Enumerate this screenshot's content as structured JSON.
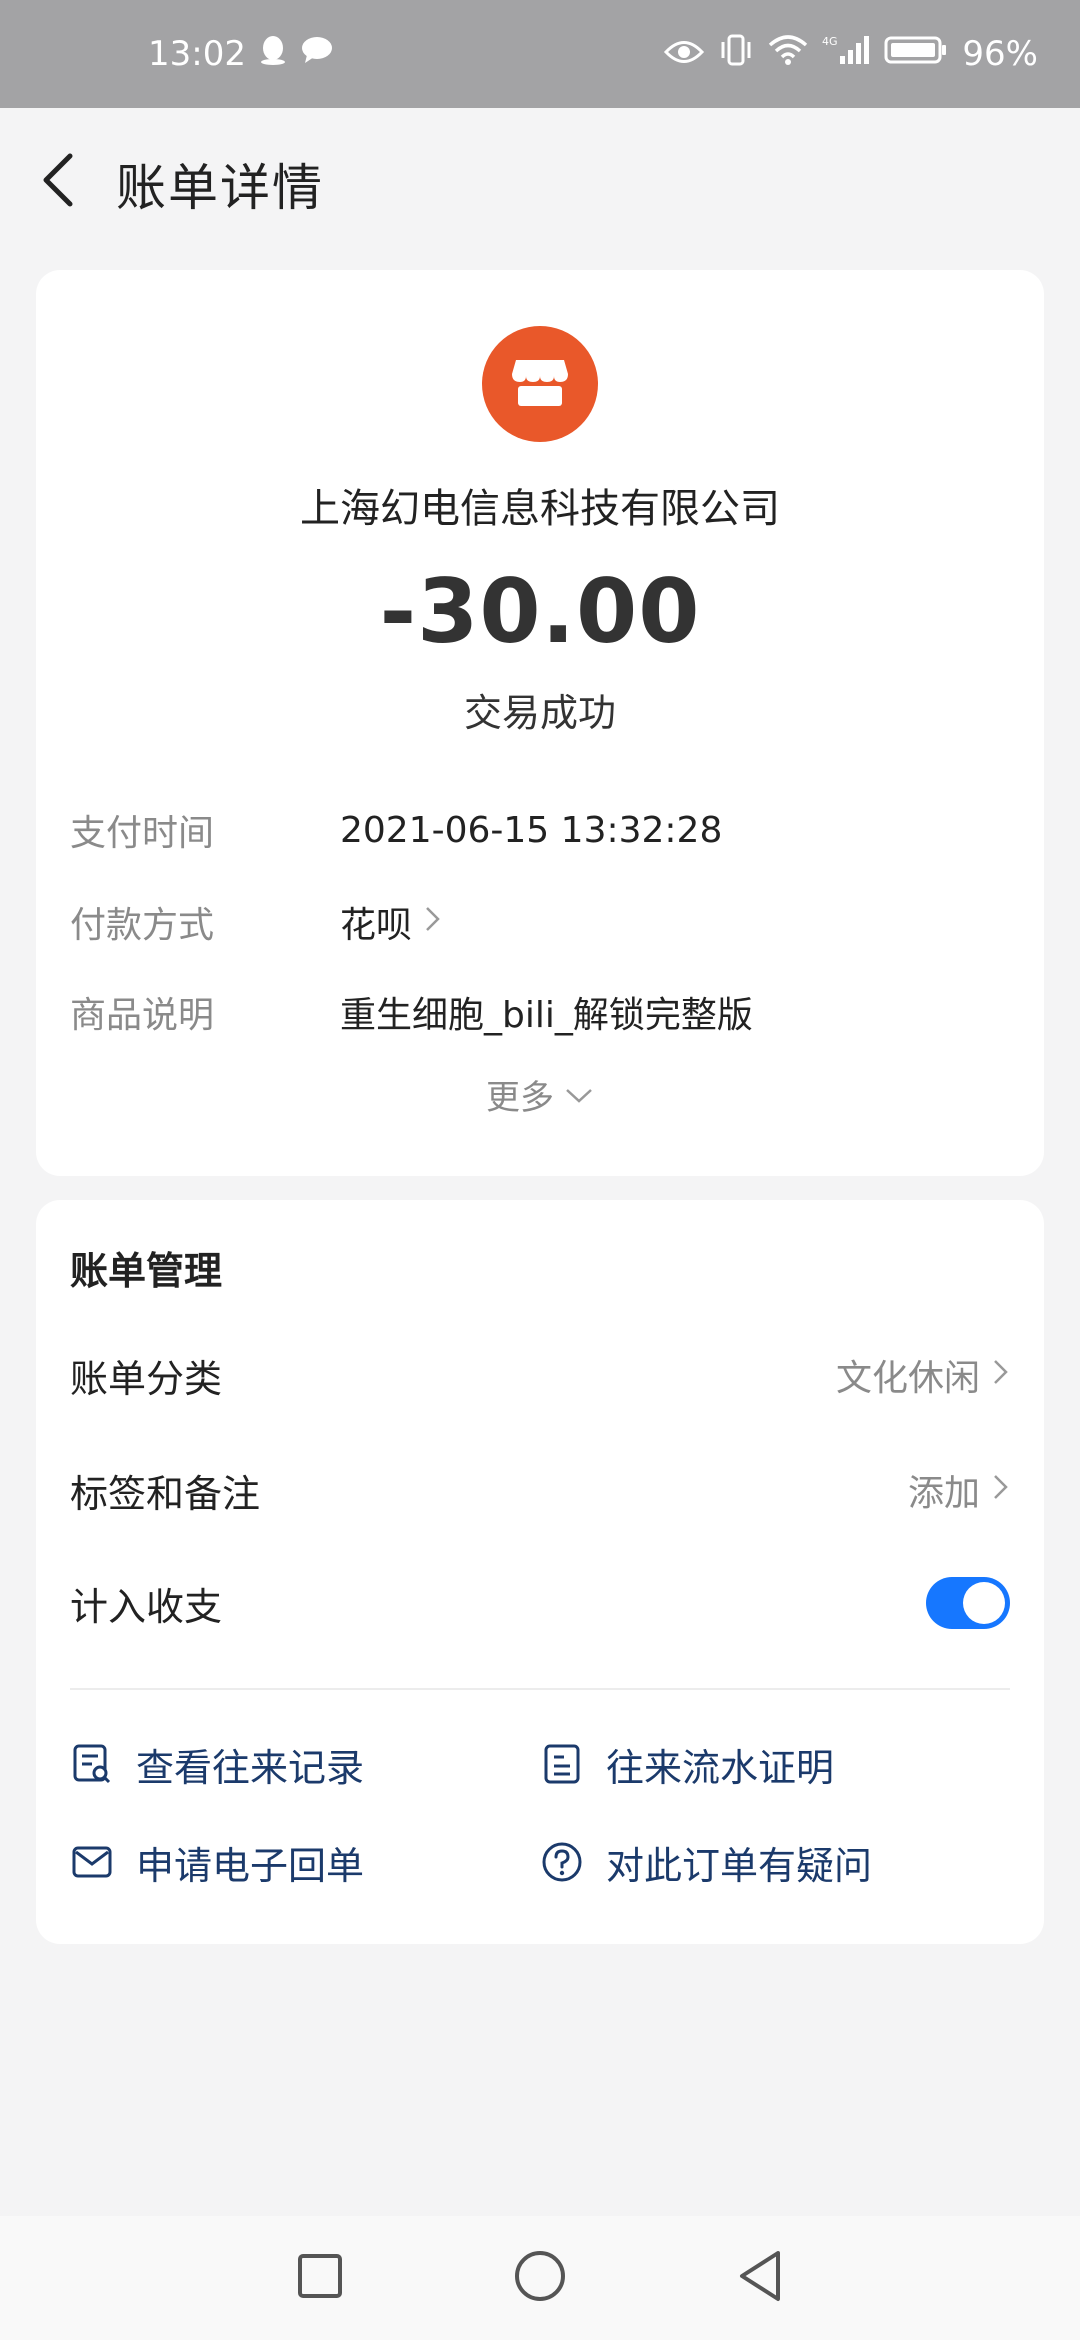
{
  "status_bar": {
    "time": "13:02",
    "battery": "96%",
    "network": "4G",
    "icons": [
      "qq-icon",
      "chat-bubble-icon",
      "eye-icon",
      "vibrate-icon",
      "wifi-icon",
      "signal-icon",
      "battery-icon"
    ]
  },
  "header": {
    "title": "账单详情",
    "back_icon": "chevron-left-icon"
  },
  "bill": {
    "merchant_icon": "shop-icon",
    "merchant_color": "#e9582a",
    "merchant_name": "上海幻电信息科技有限公司",
    "amount": "-30.00",
    "status": "交易成功",
    "details": [
      {
        "label": "支付时间",
        "value": "2021-06-15 13:32:28"
      },
      {
        "label": "付款方式",
        "value": "花呗"
      },
      {
        "label": "商品说明",
        "value": "重生细胞_bili_解锁完整版"
      }
    ],
    "more_label": "更多"
  },
  "manage": {
    "title": "账单管理",
    "category_label": "账单分类",
    "category_value": "文化休闲",
    "tags_label": "标签和备注",
    "tags_value": "添加",
    "income_label": "计入收支",
    "income_enabled": true,
    "accent_color": "#1677ff",
    "actions": [
      {
        "label": "查看往来记录",
        "icon": "records-search-icon"
      },
      {
        "label": "往来流水证明",
        "icon": "document-icon"
      },
      {
        "label": "申请电子回单",
        "icon": "mail-icon"
      },
      {
        "label": "对此订单有疑问",
        "icon": "question-circle-icon"
      }
    ]
  },
  "nav_bar": {
    "buttons": [
      "recent-apps-icon",
      "home-icon",
      "back-triangle-icon"
    ]
  }
}
